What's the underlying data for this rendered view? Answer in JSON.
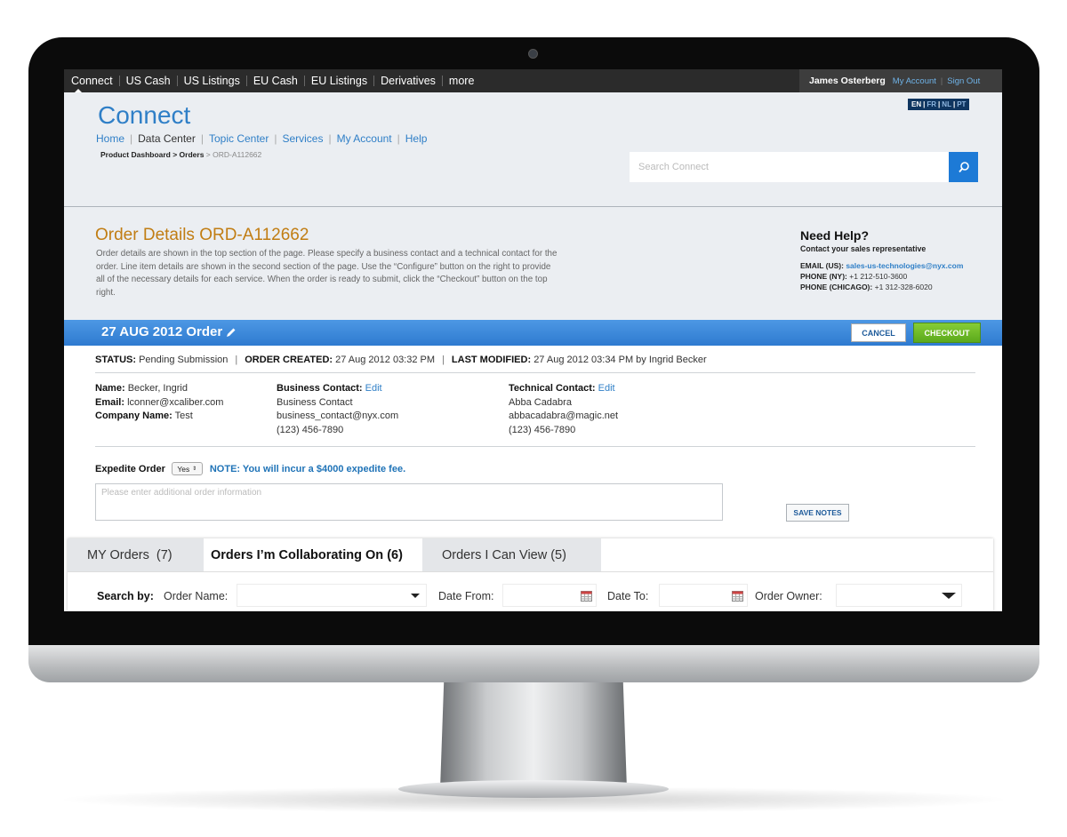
{
  "topnav": {
    "items": [
      "Connect",
      "US Cash",
      "US Listings",
      "EU Cash",
      "EU Listings",
      "Derivatives",
      "more"
    ],
    "user_name": "James Osterberg",
    "my_account": "My Account",
    "sign_out": "Sign Out"
  },
  "header": {
    "brand": "Connect",
    "nav": [
      "Home",
      "Data Center",
      "Topic Center",
      "Services",
      "My Account",
      "Help"
    ],
    "breadcrumb": {
      "part1": "Product Dashboard > Orders",
      "current": " > ORD-A112662"
    },
    "languages": [
      "EN",
      "FR",
      "NL",
      "PT"
    ],
    "search_placeholder": "Search Connect"
  },
  "intro": {
    "title": "Order Details ORD-A112662",
    "description": "Order details are shown in the top section of the page. Please specify a business contact and a technical contact for the order. Line item details are shown in the second section of the page. Use the “Configure” button on the right to provide all of the necessary details for each service. When the order is ready to submit, click the “Checkout” button on the top right."
  },
  "help": {
    "heading": "Need Help?",
    "subheading": "Contact your sales representative",
    "email_label": "EMAIL (US):",
    "email": "sales-us-technologies@nyx.com",
    "phone_ny_label": "PHONE (NY):",
    "phone_ny": "+1 212-510-3600",
    "phone_chicago_label": "PHONE (CHICAGO):",
    "phone_chicago": "+1 312-328-6020"
  },
  "order": {
    "title": "27 AUG 2012 Order",
    "cancel_label": "CANCEL",
    "checkout_label": "CHECKOUT",
    "status_label": "STATUS:",
    "status": "Pending Submission",
    "created_label": "ORDER CREATED:",
    "created": "27 Aug 2012 03:32 PM",
    "modified_label": "LAST MODIFIED:",
    "modified": "27 Aug 2012 03:34 PM by Ingrid Becker"
  },
  "customer": {
    "name_label": "Name:",
    "name": "Becker, Ingrid",
    "email_label": "Email:",
    "email": "lconner@xcaliber.com",
    "company_label": "Company Name:",
    "company": "Test"
  },
  "business_contact": {
    "label": "Business Contact:",
    "edit": "Edit",
    "name": "Business Contact",
    "email": "business_contact@nyx.com",
    "phone": "(123) 456-7890"
  },
  "technical_contact": {
    "label": "Technical Contact:",
    "edit": "Edit",
    "name": "Abba Cadabra",
    "email": "abbacadabra@magic.net",
    "phone": "(123) 456-7890"
  },
  "expedite": {
    "label": "Expedite Order",
    "value": "Yes",
    "note": "NOTE: You will incur a $4000 expedite fee."
  },
  "notes": {
    "placeholder": "Please enter additional order information",
    "save_label": "SAVE NOTES"
  },
  "tabs": [
    {
      "label": "MY Orders  (7)"
    },
    {
      "label": "Orders I’m Collaborating On (6)"
    },
    {
      "label": "Orders I Can View (5)"
    }
  ],
  "search_row": {
    "search_by": "Search by:",
    "order_name": "Order Name:",
    "date_from": "Date From:",
    "date_to": "Date To:",
    "order_owner": "Order Owner:"
  },
  "icons": {
    "search": "search-icon",
    "edit": "pencil-icon",
    "calendar": "calendar-icon",
    "dropdown": "chevron-down-icon"
  },
  "colors": {
    "brand_blue": "#2f7fc7",
    "order_bar": "#3a86d8",
    "checkout_green": "#6fbd26",
    "title_orange": "#c17d13"
  }
}
